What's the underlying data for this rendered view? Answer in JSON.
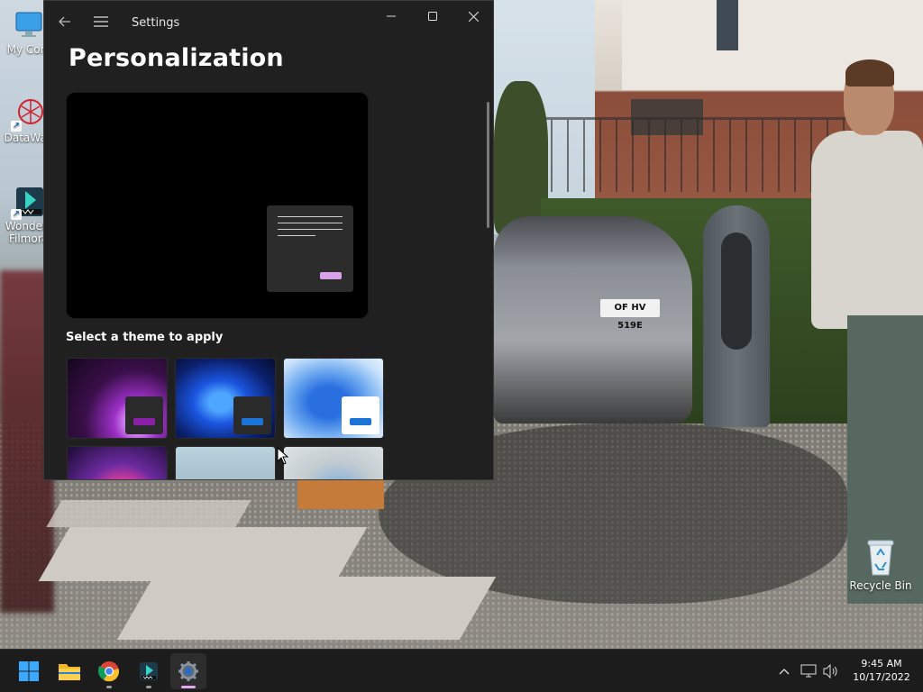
{
  "desktop": {
    "icons": [
      {
        "label": "My Com",
        "icon": "computer-icon"
      },
      {
        "label": "DataWag",
        "icon": "datawag-icon"
      },
      {
        "label": "Wonders",
        "label2": "Filmora",
        "icon": "filmora-icon"
      }
    ],
    "recycle_bin": {
      "label": "Recycle Bin",
      "icon": "recycle-bin-icon"
    },
    "wallpaper_plate": "OF HV 519E"
  },
  "window": {
    "app_title": "Settings",
    "page_title": "Personalization",
    "section_label": "Select a theme to apply",
    "controls": {
      "back": "back-arrow-icon",
      "menu": "hamburger-icon",
      "minimize": "minimize-icon",
      "maximize": "maximize-icon",
      "close": "close-icon"
    },
    "preview": {
      "background": "#000000",
      "accent": "#d8a2e8"
    },
    "themes": [
      {
        "name": "theme-glow-purple",
        "bg": "#3a0f4a",
        "mini_bg": "#2a2a2a",
        "accent": "#8b1fa8"
      },
      {
        "name": "theme-windows-dark",
        "bg": "#0f2a8a",
        "mini_bg": "#2a2a2a",
        "accent": "#1a73d6"
      },
      {
        "name": "theme-windows-light",
        "bg": "#3c7ed8",
        "mini_bg": "#ffffff",
        "accent": "#1a73d6"
      },
      {
        "name": "theme-captured-motion",
        "bg": "#2a1450"
      },
      {
        "name": "theme-sunrise",
        "bg": "#9fb5c0"
      },
      {
        "name": "theme-flow",
        "bg": "#b7c2c8"
      }
    ]
  },
  "taskbar": {
    "apps": [
      {
        "name": "start",
        "icon": "windows-start-icon"
      },
      {
        "name": "file-explorer",
        "icon": "folder-icon"
      },
      {
        "name": "chrome",
        "icon": "chrome-icon"
      },
      {
        "name": "filmora",
        "icon": "filmora-icon"
      },
      {
        "name": "settings",
        "icon": "gear-icon"
      }
    ],
    "tray": [
      "chevron-up-icon",
      "network-icon",
      "volume-icon"
    ],
    "time": "9:45 AM",
    "date": "10/17/2022"
  }
}
